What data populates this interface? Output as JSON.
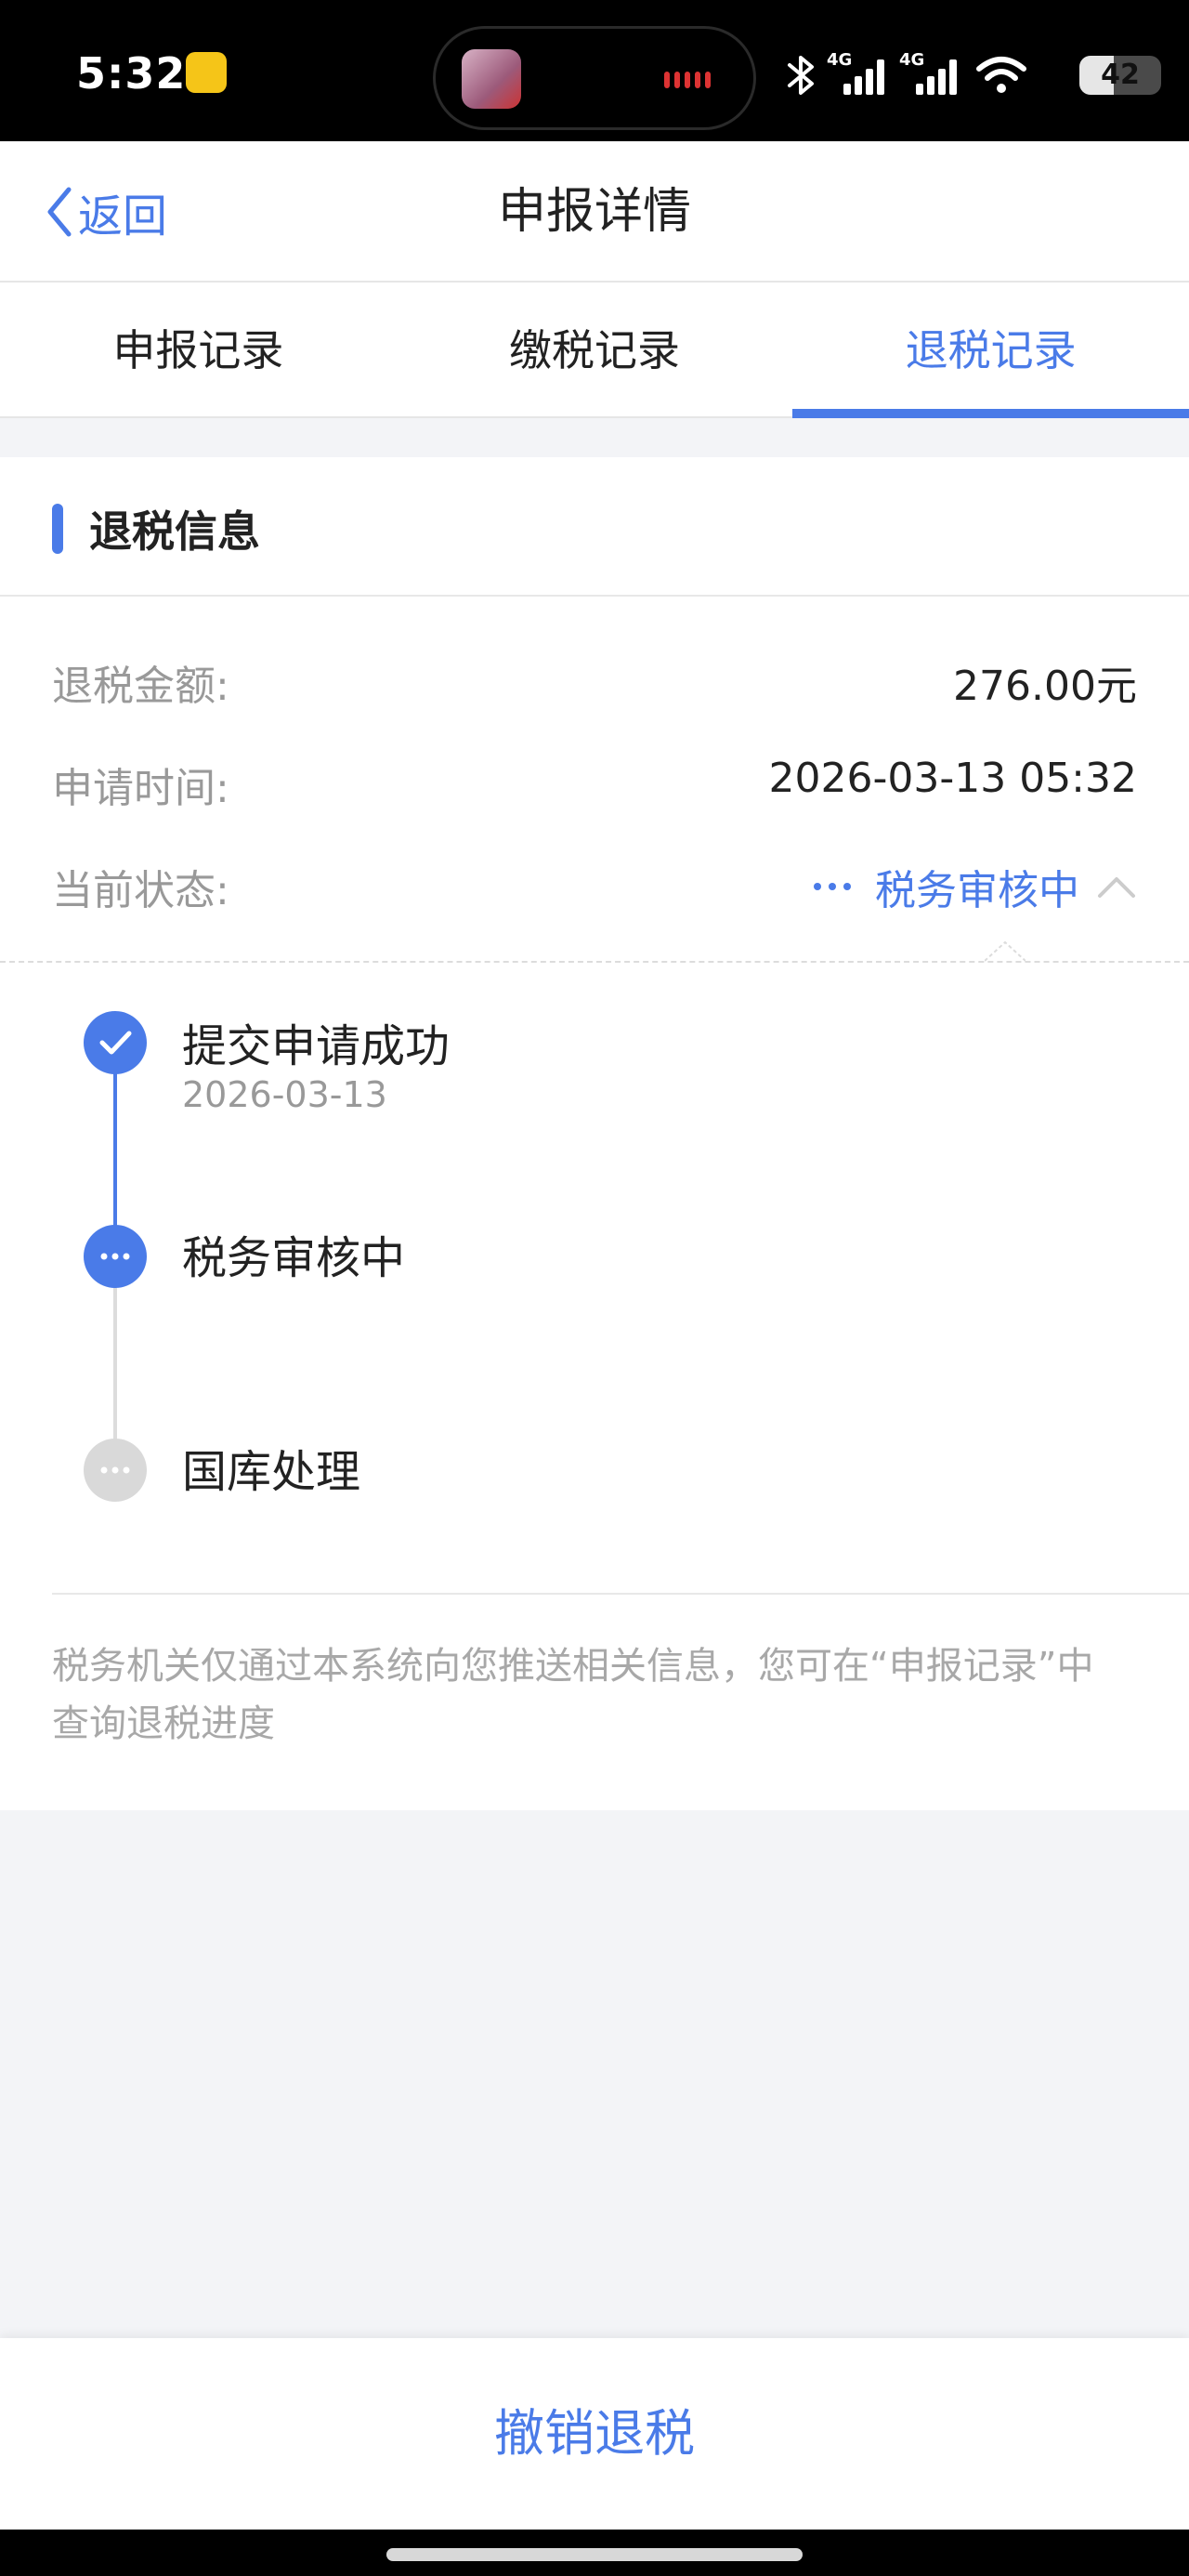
{
  "status_bar": {
    "time": "5:32",
    "network_1": "4G",
    "network_2": "4G",
    "battery": "42",
    "battery_level": 0.42,
    "icons": [
      "app-notification-icon",
      "bluetooth-icon",
      "signal-icon",
      "wifi-icon",
      "battery-icon"
    ]
  },
  "nav": {
    "back_label": "返回",
    "title": "申报详情"
  },
  "tabs": [
    {
      "label": "申报记录",
      "active": false
    },
    {
      "label": "缴税记录",
      "active": false
    },
    {
      "label": "退税记录",
      "active": true
    }
  ],
  "refund": {
    "section_title": "退税信息",
    "amount_label": "退税金额:",
    "amount_value": "276.00元",
    "time_label": "申请时间:",
    "time_value": "2026-03-13 05:32",
    "status_label": "当前状态:",
    "status_value": "税务审核中"
  },
  "timeline": [
    {
      "title": "提交申请成功",
      "date": "2026-03-13",
      "state": "done"
    },
    {
      "title": "税务审核中",
      "date": "",
      "state": "current"
    },
    {
      "title": "国库处理",
      "date": "",
      "state": "pending"
    }
  ],
  "notice": "税务机关仅通过本系统向您推送相关信息，您可在“申报记录”中查询退税进度",
  "bottom": {
    "cancel_label": "撤销退税"
  },
  "colors": {
    "accent": "#4a7be8",
    "pending": "#d9d9d9",
    "muted_text": "#999999"
  }
}
